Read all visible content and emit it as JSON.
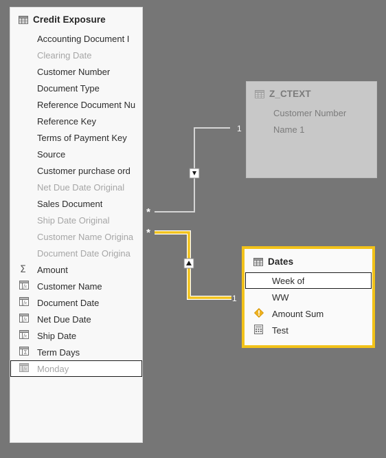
{
  "canvas": {
    "background_color": "#767676",
    "highlight_color": "#f2c219",
    "relationship_line_color": "#d5d5d5"
  },
  "tables": [
    {
      "name": "Credit Exposure",
      "state": "normal",
      "header_icon": "table-grid-icon",
      "fields": [
        {
          "label": "Accounting Document I",
          "icon": "none",
          "hidden": false,
          "selected": false
        },
        {
          "label": "Clearing Date",
          "icon": "none",
          "hidden": true,
          "selected": false
        },
        {
          "label": "Customer Number",
          "icon": "none",
          "hidden": false,
          "selected": false
        },
        {
          "label": "Document Type",
          "icon": "none",
          "hidden": false,
          "selected": false
        },
        {
          "label": "Reference Document Nu",
          "icon": "none",
          "hidden": false,
          "selected": false
        },
        {
          "label": "Reference Key",
          "icon": "none",
          "hidden": false,
          "selected": false
        },
        {
          "label": "Terms of Payment Key",
          "icon": "none",
          "hidden": false,
          "selected": false
        },
        {
          "label": "Source",
          "icon": "none",
          "hidden": false,
          "selected": false
        },
        {
          "label": "Customer purchase ord",
          "icon": "none",
          "hidden": false,
          "selected": false
        },
        {
          "label": "Net Due Date Original",
          "icon": "none",
          "hidden": true,
          "selected": false
        },
        {
          "label": "Sales Document",
          "icon": "none",
          "hidden": false,
          "selected": false
        },
        {
          "label": "Ship Date Original",
          "icon": "none",
          "hidden": true,
          "selected": false
        },
        {
          "label": "Customer Name Origina",
          "icon": "none",
          "hidden": true,
          "selected": false
        },
        {
          "label": "Document Date Origina",
          "icon": "none",
          "hidden": true,
          "selected": false
        },
        {
          "label": "Amount",
          "icon": "sigma-icon",
          "hidden": false,
          "selected": false
        },
        {
          "label": "Customer Name",
          "icon": "calculated-column-icon",
          "hidden": false,
          "selected": false
        },
        {
          "label": "Document Date",
          "icon": "calculated-column-icon",
          "hidden": false,
          "selected": false
        },
        {
          "label": "Net Due Date",
          "icon": "calculated-column-icon",
          "hidden": false,
          "selected": false
        },
        {
          "label": "Ship Date",
          "icon": "calculated-column-icon",
          "hidden": false,
          "selected": false
        },
        {
          "label": "Term Days",
          "icon": "calculated-sum-column-icon",
          "hidden": false,
          "selected": false
        },
        {
          "label": "Monday",
          "icon": "calculated-column-icon",
          "hidden": true,
          "selected": true
        }
      ]
    },
    {
      "name": "Z_CTEXT",
      "state": "dimmed",
      "header_icon": "table-grid-icon",
      "fields": [
        {
          "label": "Customer Number",
          "icon": "none",
          "hidden": false,
          "selected": false
        },
        {
          "label": "Name 1",
          "icon": "none",
          "hidden": false,
          "selected": false
        }
      ]
    },
    {
      "name": "Dates",
      "state": "highlighted",
      "header_icon": "table-grid-icon",
      "fields": [
        {
          "label": "Week of",
          "icon": "none",
          "hidden": false,
          "selected": true
        },
        {
          "label": "WW",
          "icon": "none",
          "hidden": false,
          "selected": false
        },
        {
          "label": "Amount Sum",
          "icon": "warning-measure-icon",
          "hidden": false,
          "selected": false
        },
        {
          "label": "Test",
          "icon": "measure-calculator-icon",
          "hidden": false,
          "selected": false
        }
      ]
    }
  ],
  "relationships": [
    {
      "id": "credit-exposure-to-z-ctext",
      "from_cardinality": "*",
      "to_cardinality": "1",
      "highlighted": false,
      "cross_filter_marker": "filter-direction-down-icon"
    },
    {
      "id": "credit-exposure-to-dates",
      "from_cardinality": "*",
      "to_cardinality": "1",
      "highlighted": true,
      "cross_filter_marker": "filter-direction-up-icon"
    }
  ]
}
